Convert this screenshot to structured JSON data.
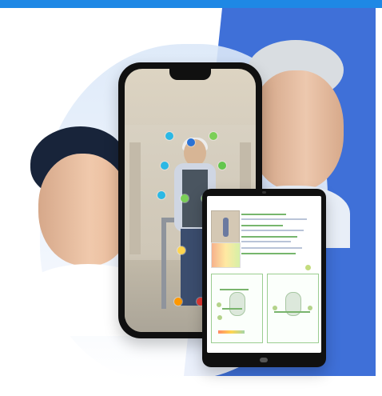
{
  "report": {
    "title": "",
    "left_section": "",
    "right_section": "",
    "footer_label": "",
    "status": ""
  },
  "colors": {
    "blue": "#3f70d8",
    "accent": "#1e88e5",
    "joint_blue": "#2bb8e5",
    "joint_green": "#7bcf57",
    "joint_yellow": "#ffd54f",
    "joint_orange": "#ff9800",
    "joint_red": "#e53935"
  }
}
